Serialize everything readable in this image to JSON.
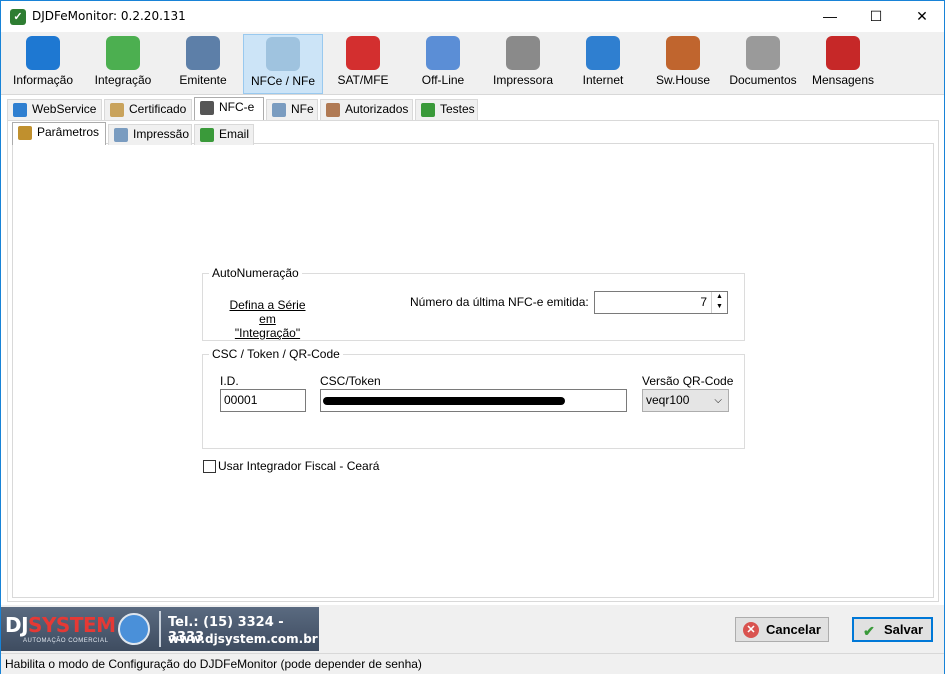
{
  "window": {
    "title": "DJDFeMonitor: 0.2.20.131"
  },
  "window_controls": {
    "minimize": "—",
    "maximize": "☐",
    "close": "✕"
  },
  "toolbar": [
    {
      "label": "Informação",
      "icon": "info-icon",
      "color": "#1e78d2"
    },
    {
      "label": "Integração",
      "icon": "arrows-icon",
      "color": "#4caf50"
    },
    {
      "label": "Emitente",
      "icon": "person-icon",
      "color": "#5d7fa8"
    },
    {
      "label": "NFCe / NFe",
      "icon": "document-icon",
      "color": "#9fc3df"
    },
    {
      "label": "SAT/MFE",
      "icon": "at-icon",
      "color": "#d32f2f"
    },
    {
      "label": "Off-Line",
      "icon": "plug-icon",
      "color": "#5b8ed6"
    },
    {
      "label": "Impressora",
      "icon": "printer-icon",
      "color": "#8a8a8a"
    },
    {
      "label": "Internet",
      "icon": "globe-icon",
      "color": "#2f7fd0"
    },
    {
      "label": "Sw.House",
      "icon": "headset-icon",
      "color": "#c0652e"
    },
    {
      "label": "Documentos",
      "icon": "documents-icon",
      "color": "#9a9a9a"
    },
    {
      "label": "Mensagens",
      "icon": "mailbox-icon",
      "color": "#c62828"
    }
  ],
  "tabs_main": [
    {
      "label": "WebService",
      "icon": "globe-icon",
      "color": "#2f7fd0"
    },
    {
      "label": "Certificado",
      "icon": "certificate-icon",
      "color": "#c9a35c"
    },
    {
      "label": "NFC-e",
      "icon": "qrcode-icon",
      "color": "#555555"
    },
    {
      "label": "NFe",
      "icon": "document-icon",
      "color": "#7a9cc0"
    },
    {
      "label": "Autorizados",
      "icon": "users-icon",
      "color": "#b07a54"
    },
    {
      "label": "Testes",
      "icon": "check-icon",
      "color": "#3a9a3a"
    }
  ],
  "tabs_sub": [
    {
      "label": "Parâmetros",
      "icon": "wrench-icon",
      "color": "#c0902e"
    },
    {
      "label": "Impressão",
      "icon": "document-icon",
      "color": "#7a9cc0"
    },
    {
      "label": "Email",
      "icon": "email-icon",
      "color": "#3a9a3a"
    }
  ],
  "autonumeracao": {
    "title": "AutoNumeração",
    "link_line1": "Defina a Série em",
    "link_line2": "\"Integração\"",
    "ultima_label": "Número da última NFC-e emitida:",
    "ultima_value": "7",
    "spin_up": "▲",
    "spin_down": "▼"
  },
  "csc": {
    "title": "CSC / Token / QR-Code",
    "id_label": "I.D.",
    "id_value": "00001",
    "token_label": "CSC/Token",
    "versao_label": "Versão QR-Code",
    "versao_value": "veqr100",
    "chevron": "⌵"
  },
  "integrador": {
    "label": "Usar Integrador Fiscal - Ceará",
    "checked": false
  },
  "brand": {
    "name_dj": "DJ",
    "name_system": "SYSTEM",
    "subtitle": "AUTOMAÇÃO COMERCIAL",
    "phone": "Tel.: (15) 3324 - 3333",
    "website": "www.djsystem.com.br"
  },
  "buttons": {
    "cancel_label": "Cancelar",
    "cancel_icon_glyph": "✕",
    "save_label": "Salvar",
    "save_icon_glyph": "✔"
  },
  "status_bar": {
    "text": "Habilita o modo de Configuração do DJDFeMonitor (pode depender de senha)"
  }
}
